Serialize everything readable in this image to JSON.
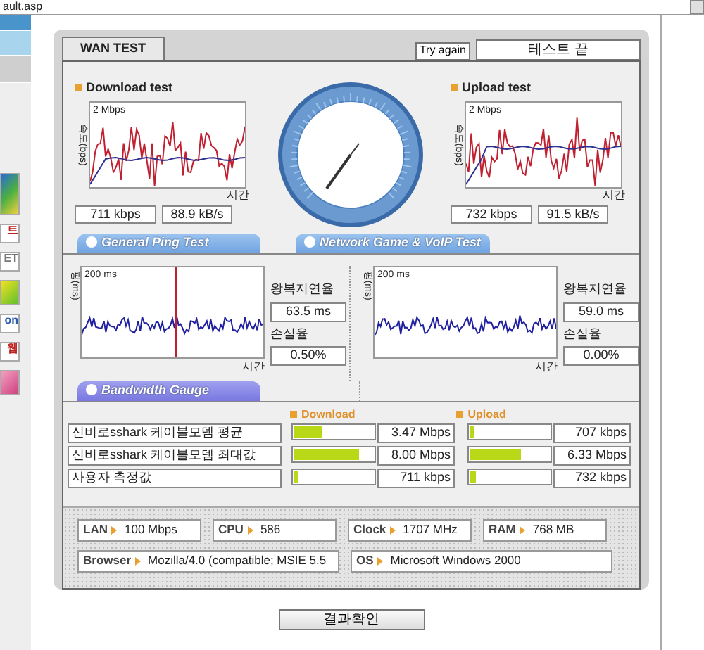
{
  "address_bar": {
    "text": "ault.asp"
  },
  "side_banners": [
    {
      "kind": "picture"
    },
    {
      "kind": "text",
      "label": "트"
    },
    {
      "kind": "text",
      "label": "ET"
    },
    {
      "kind": "picture"
    },
    {
      "kind": "text",
      "label": "on"
    },
    {
      "kind": "text",
      "label": "웹"
    },
    {
      "kind": "picture"
    }
  ],
  "header": {
    "tab": "WAN TEST",
    "try_again": "Try again",
    "status": "테스트 끝"
  },
  "speed_tests": [
    {
      "title": "Download test",
      "y_axis": "속도(bps)",
      "scale": "2 Mbps",
      "x_axis": "시간",
      "speed": "711 kbps",
      "rate": "88.9 kB/s"
    },
    {
      "title": "Upload test",
      "y_axis": "속도(bps)",
      "scale": "2 Mbps",
      "x_axis": "시간",
      "speed": "732 kbps",
      "rate": "91.5 kB/s"
    }
  ],
  "ping_tests": [
    {
      "tab": "General Ping Test",
      "y_axis": "핑(ms)",
      "scale": "200 ms",
      "x_axis": "시간",
      "latency_label": "왕복지연율",
      "latency": "63.5 ms",
      "loss_label": "손실율",
      "loss": "0.50%"
    },
    {
      "tab": "Network Game & VoIP Test",
      "y_axis": "핑(ms)",
      "scale": "200 ms",
      "x_axis": "시간",
      "latency_label": "왕복지연율",
      "latency": "59.0 ms",
      "loss_label": "손실율",
      "loss": "0.00%"
    }
  ],
  "bandwidth": {
    "tab": "Bandwidth Gauge",
    "download_header": "Download",
    "upload_header": "Upload",
    "rows": [
      {
        "label": "신비로sshark 케이블모뎀 평균",
        "download": {
          "level": 0.35,
          "reading": "3.47 Mbps"
        },
        "upload": {
          "level": 0.06,
          "reading": "707 kbps"
        }
      },
      {
        "label": "신비로sshark 케이블모뎀 최대값",
        "download": {
          "level": 0.82,
          "reading": "8.00 Mbps"
        },
        "upload": {
          "level": 0.65,
          "reading": "6.33 Mbps"
        }
      },
      {
        "label": "사용자 측정값",
        "download": {
          "level": 0.05,
          "reading": "711 kbps"
        },
        "upload": {
          "level": 0.07,
          "reading": "732 kbps"
        }
      }
    ]
  },
  "system_info": [
    [
      {
        "label": "LAN",
        "value": "100 Mbps"
      },
      {
        "label": "CPU",
        "value": "586"
      },
      {
        "label": "Clock",
        "value": "1707 MHz"
      },
      {
        "label": "RAM",
        "value": "768 MB"
      }
    ],
    [
      {
        "label": "Browser",
        "value": "Mozilla/4.0 (compatible; MSIE 5.5"
      },
      {
        "label": "OS",
        "value": "Microsoft Windows 2000"
      }
    ]
  ],
  "result_button": "결과확인"
}
